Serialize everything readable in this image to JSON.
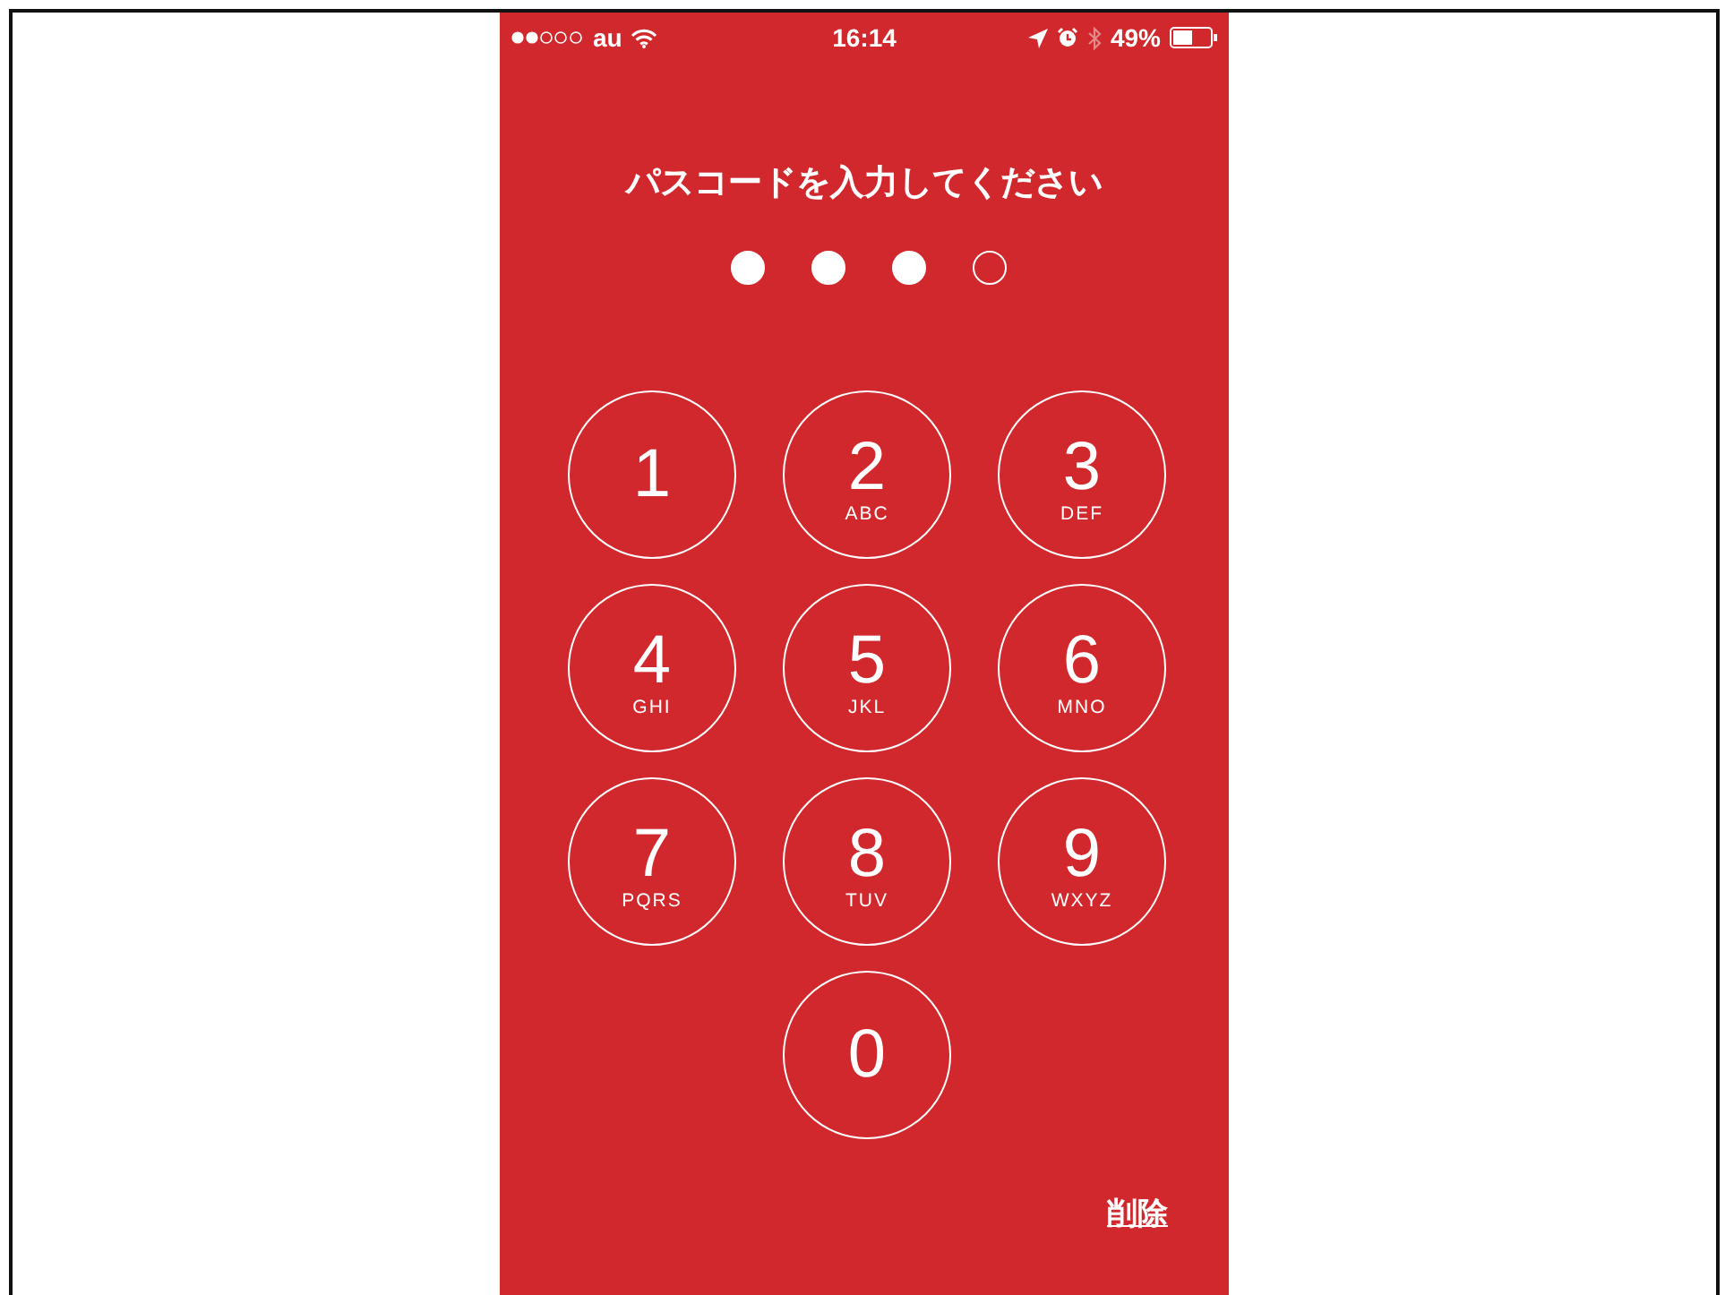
{
  "status_bar": {
    "carrier": "au",
    "time": "16:14",
    "battery": "49%"
  },
  "prompt": "パスコードを入力してください",
  "passcode_dots": [
    {
      "filled": true
    },
    {
      "filled": true
    },
    {
      "filled": true
    },
    {
      "filled": false
    }
  ],
  "keys": [
    {
      "digit": "1"
    },
    {
      "digit": "2",
      "letters": "ABC"
    },
    {
      "digit": "3",
      "letters": "DEF"
    },
    {
      "digit": "4",
      "letters": "GHI"
    },
    {
      "digit": "5",
      "letters": "JKL"
    },
    {
      "digit": "6",
      "letters": "MNO"
    },
    {
      "digit": "7",
      "letters": "PQRS"
    },
    {
      "digit": "8",
      "letters": "TUV"
    },
    {
      "digit": "9",
      "letters": "WXYZ"
    },
    {
      "digit": "0"
    }
  ],
  "delete_button": "削除"
}
